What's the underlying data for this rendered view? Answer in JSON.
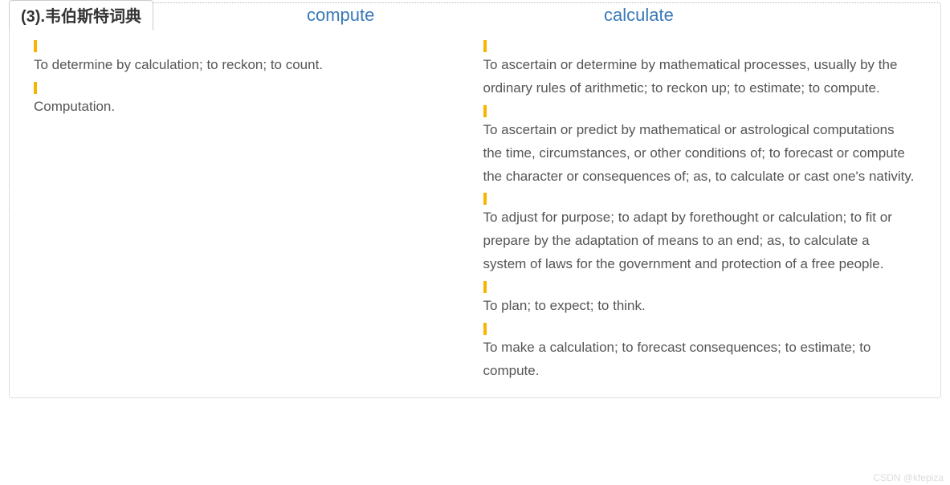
{
  "tab": {
    "label": "(3).韦伯斯特词典"
  },
  "header": {
    "left_word": "compute",
    "right_word": "calculate"
  },
  "left_defs": [
    "To determine by calculation; to reckon; to count.",
    "Computation."
  ],
  "right_defs": [
    "To ascertain or determine by mathematical processes, usually by the ordinary rules of arithmetic; to reckon up; to estimate; to compute.",
    "To ascertain or predict by mathematical or astrological computations the time, circumstances, or other conditions of; to forecast or compute the character or consequences of; as, to calculate or cast one's nativity.",
    "To adjust for purpose; to adapt by forethought or calculation; to fit or prepare by the adaptation of means to an end; as, to calculate a system of laws for the government and protection of a free people.",
    "To plan; to expect; to think.",
    "To make a calculation; to forecast consequences; to estimate; to compute."
  ],
  "watermark": "CSDN @kfepiza"
}
